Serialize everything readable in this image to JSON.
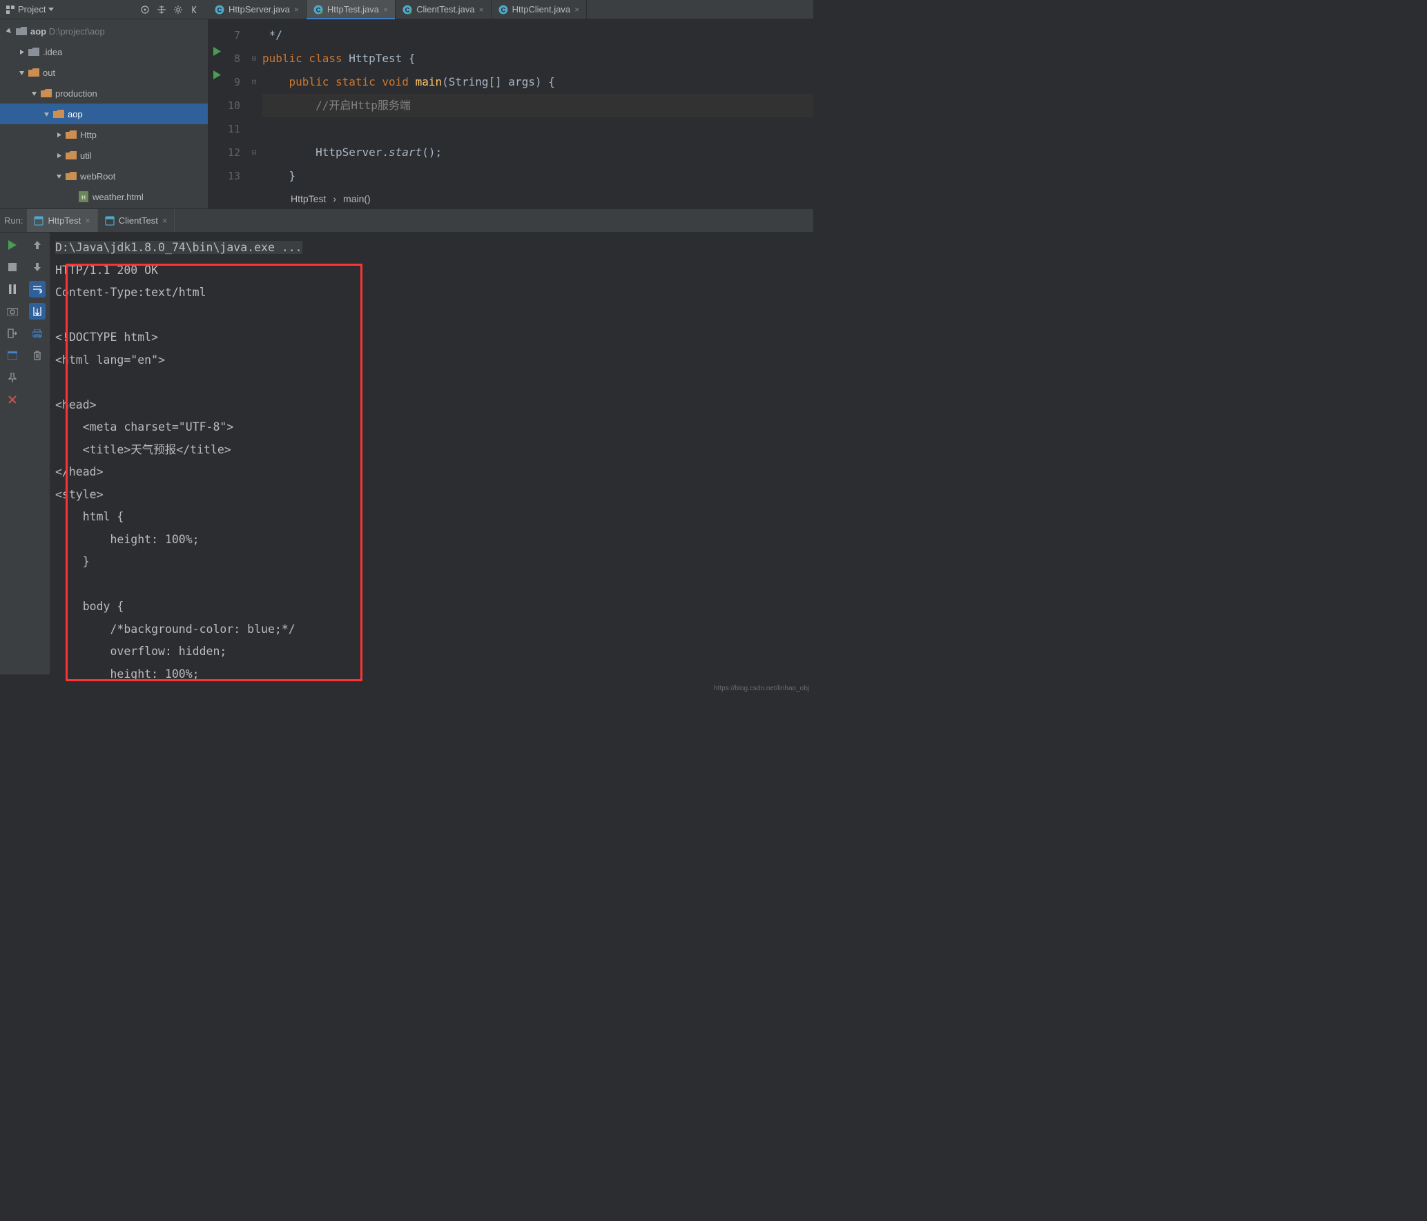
{
  "sidebar": {
    "title": "Project",
    "root": {
      "name": "aop",
      "path": "D:\\project\\aop"
    },
    "items": [
      {
        "indent": 1,
        "expand": "closed",
        "icon": "folder-grey",
        "label": ".idea"
      },
      {
        "indent": 1,
        "expand": "open",
        "icon": "folder-orange",
        "label": "out"
      },
      {
        "indent": 2,
        "expand": "open",
        "icon": "folder-orange",
        "label": "production"
      },
      {
        "indent": 3,
        "expand": "open",
        "icon": "folder-orange",
        "label": "aop",
        "selected": true
      },
      {
        "indent": 4,
        "expand": "closed",
        "icon": "folder-orange",
        "label": "Http"
      },
      {
        "indent": 4,
        "expand": "closed",
        "icon": "folder-orange",
        "label": "util"
      },
      {
        "indent": 4,
        "expand": "open",
        "icon": "folder-orange",
        "label": "webRoot"
      },
      {
        "indent": 5,
        "expand": "none",
        "icon": "html-file",
        "label": "weather.html"
      }
    ]
  },
  "tabs": [
    {
      "icon": "c-blue",
      "label": "HttpServer.java",
      "active": false
    },
    {
      "icon": "c-green-run",
      "label": "HttpTest.java",
      "active": true
    },
    {
      "icon": "c-green-run",
      "label": "ClientTest.java",
      "active": false
    },
    {
      "icon": "c-blue",
      "label": "HttpClient.java",
      "active": false
    }
  ],
  "code_lines": [
    {
      "n": "7",
      "play": false,
      "fold": "",
      "html": " */"
    },
    {
      "n": "8",
      "play": true,
      "fold": "⊟",
      "html": "<span class='kw'>public class</span> <span class='cls'>HttpTest</span> {"
    },
    {
      "n": "9",
      "play": true,
      "fold": "⊟",
      "html": "    <span class='kw'>public static void</span> <span class='fn' style='color:#ffc66d;font-style:normal'>main</span>(String[] args) {"
    },
    {
      "n": "10",
      "play": false,
      "fold": "",
      "html": "        <span class='cm'>//开启Http服务端</span>",
      "sel": true
    },
    {
      "n": "11",
      "play": false,
      "fold": "",
      "html": "        HttpServer.<span style='font-style:italic'>start</span>();"
    },
    {
      "n": "12",
      "play": false,
      "fold": "⊟",
      "html": "    }"
    },
    {
      "n": "13",
      "play": false,
      "fold": "",
      "html": "}"
    }
  ],
  "breadcrumb": {
    "a": "HttpTest",
    "b": "main()"
  },
  "run_bar": {
    "label": "Run:",
    "tabs": [
      {
        "label": "HttpTest",
        "active": true
      },
      {
        "label": "ClientTest",
        "active": false
      }
    ]
  },
  "console_lines": [
    "D:\\Java\\jdk1.8.0_74\\bin\\java.exe ...",
    "HTTP/1.1 200 OK",
    "Content-Type:text/html",
    "",
    "<!DOCTYPE html>",
    "<html lang=\"en\">",
    "",
    "<head>",
    "    <meta charset=\"UTF-8\">",
    "    <title>天气预报</title>",
    "</head>",
    "<style>",
    "    html {",
    "        height: 100%;",
    "    }",
    "",
    "    body {",
    "        /*background-color: blue;*/",
    "        overflow: hidden;",
    "        height: 100%;"
  ],
  "watermark": "https://blog.csdn.net/linhao_obj"
}
